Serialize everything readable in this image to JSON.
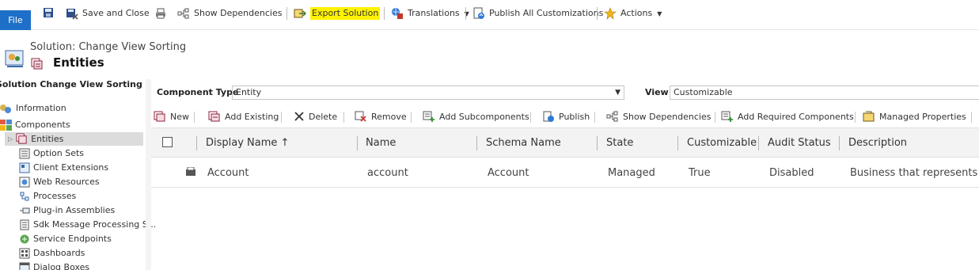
{
  "toolbar": {
    "file": "File",
    "save_close": "Save and Close",
    "show_dependencies": "Show Dependencies",
    "export_solution": "Export Solution",
    "translations": "Translations",
    "publish_all": "Publish All Customizations",
    "actions": "Actions"
  },
  "header": {
    "solution_title": "Solution: Change View Sorting",
    "entity_title": "Entities",
    "solution_name": "Solution Change View Sorting"
  },
  "nav": {
    "information": "Information",
    "components": "Components",
    "items": [
      "Entities",
      "Option Sets",
      "Client Extensions",
      "Web Resources",
      "Processes",
      "Plug-in Assemblies",
      "Sdk Message Processing S...",
      "Service Endpoints",
      "Dashboards",
      "Dialog Boxes"
    ]
  },
  "filters": {
    "component_type_label": "Component Type",
    "component_type_value": "Entity",
    "view_label": "View",
    "view_value": "Customizable"
  },
  "subtoolbar": {
    "new": "New",
    "add_existing": "Add Existing",
    "delete": "Delete",
    "remove": "Remove",
    "add_subcomponents": "Add Subcomponents",
    "publish": "Publish",
    "show_dependencies": "Show Dependencies",
    "add_required": "Add Required Components",
    "managed_properties": "Managed Properties"
  },
  "grid": {
    "columns": [
      "Display Name ↑",
      "Name",
      "Schema Name",
      "State",
      "Customizable",
      "Audit Status",
      "Description"
    ],
    "rows": [
      {
        "display_name": "Account",
        "name": "account",
        "schema_name": "Account",
        "state": "Managed",
        "customizable": "True",
        "audit_status": "Disabled",
        "description": "Business that represents a cu"
      }
    ]
  },
  "colors": {
    "file_button": "#1d6fc8",
    "highlight": "#fff200",
    "nav_selected": "#dcdcdc",
    "grid_header": "#f3f3f3"
  }
}
